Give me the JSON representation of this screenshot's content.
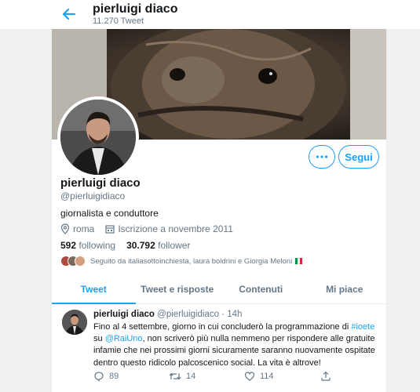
{
  "header": {
    "title": "pierluigi diaco",
    "tweet_count": "11.270 Tweet"
  },
  "profile": {
    "name": "pierluigi diaco",
    "handle": "@pierluigidiaco",
    "bio": "giornalista e conduttore",
    "location": "roma",
    "joined": "Iscrizione a novembre 2011",
    "following_count": "592",
    "following_label": "following",
    "followers_count": "30.792",
    "followers_label": "follower",
    "followed_by": "Seguito da italiasottoinchiesta, laura boldrini e Giorgia Meloni",
    "follow_label": "Segui"
  },
  "tabs": [
    {
      "label": "Tweet",
      "active": true
    },
    {
      "label": "Tweet e risposte",
      "active": false
    },
    {
      "label": "Contenuti",
      "active": false
    },
    {
      "label": "Mi piace",
      "active": false
    }
  ],
  "tweet": {
    "author": "pierluigi diaco",
    "handle": "@pierluigidiaco",
    "separator": "·",
    "time": "14h",
    "text_1": "Fino al 4 settembre, giorno in cui concluderò la programmazione di ",
    "hashtag": "#ioete",
    "text_2": " su ",
    "mention": "@RaiUno",
    "text_3": ", non scriverò più nulla nemmeno per rispondere alle gratuite infamie che nei prossimi giorni sicuramente saranno nuovamente ospitate dentro questo ridicolo palcoscenico social. La vita è altrove!",
    "replies": "89",
    "retweets": "14",
    "likes": "114"
  },
  "colors": {
    "accent": "#1da1f2",
    "secondary_text": "#657786",
    "flag": [
      "#009246",
      "#ffffff",
      "#ce2b37"
    ]
  }
}
